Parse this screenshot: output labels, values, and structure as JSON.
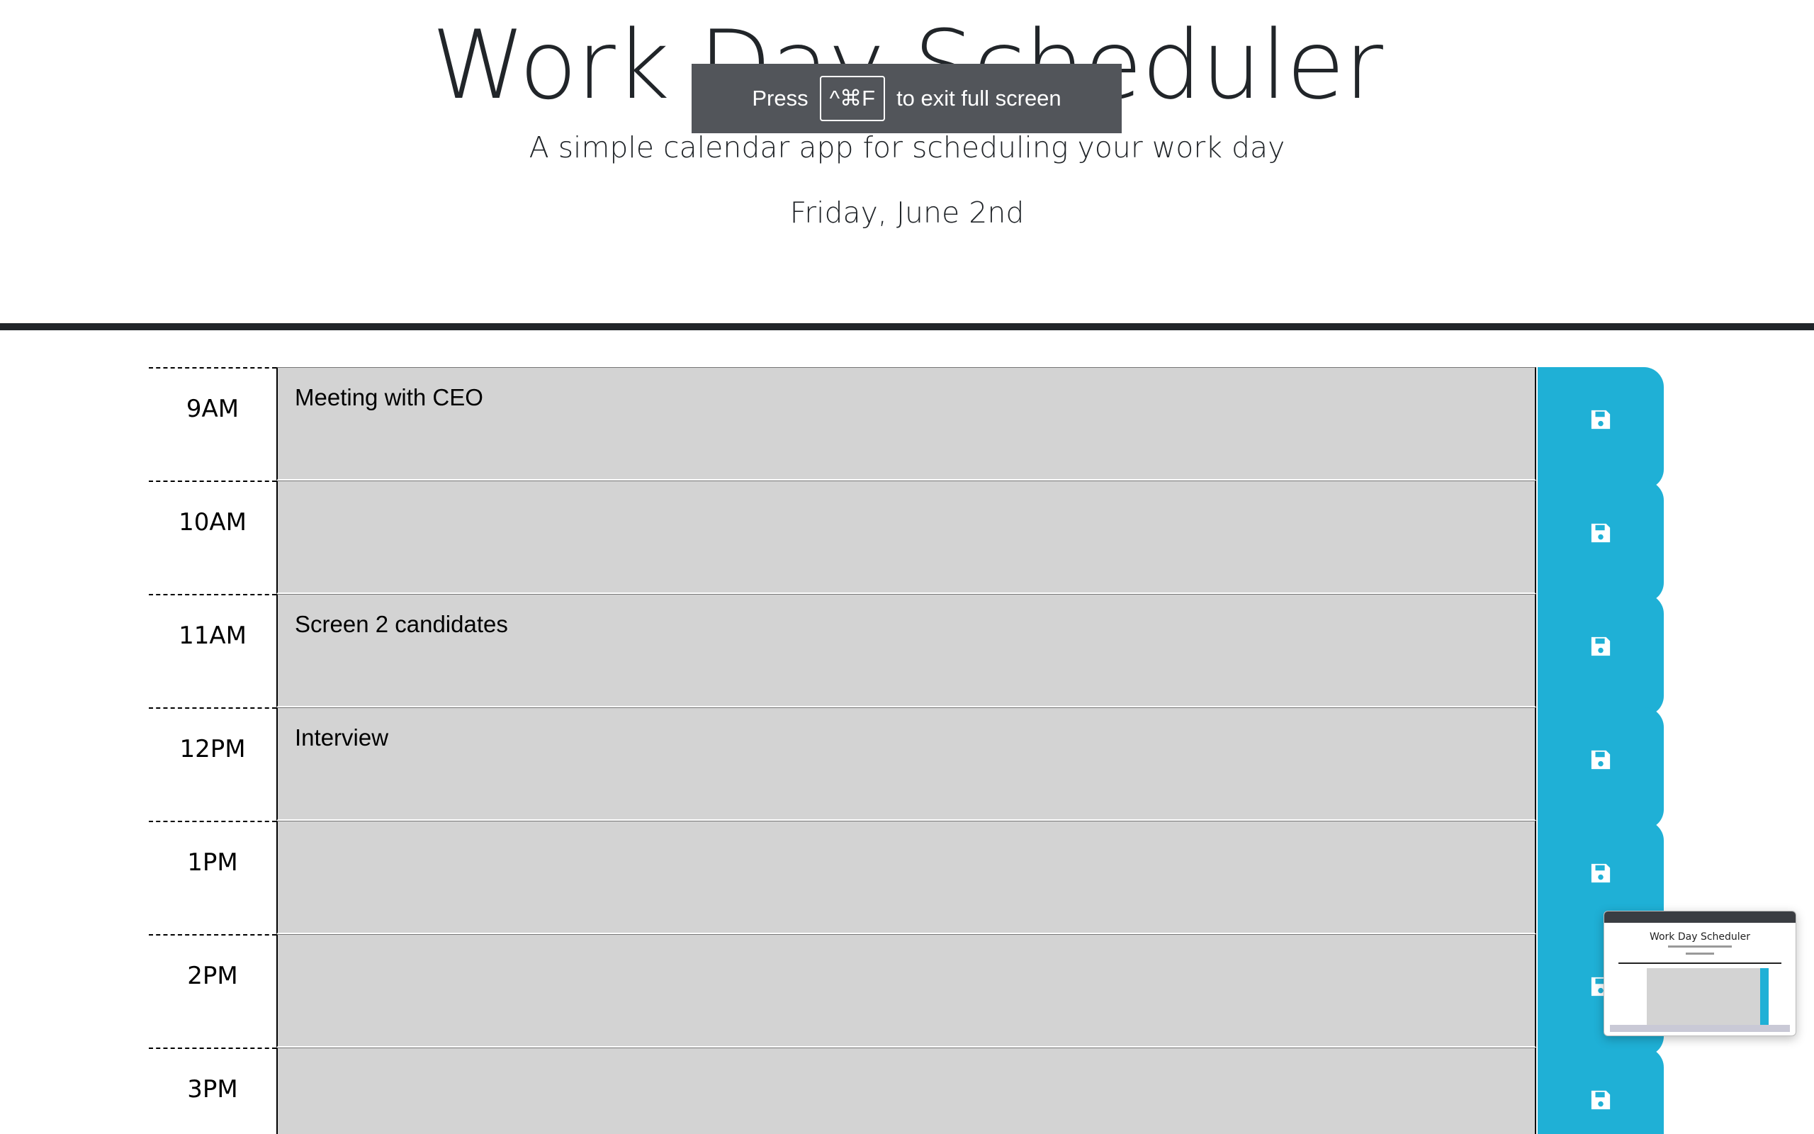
{
  "header": {
    "title": "Work Day Scheduler",
    "lead": "A simple calendar app for scheduling your work day",
    "current_day": "Friday, June 2nd"
  },
  "fullscreen_toast": {
    "press": "Press",
    "key": "^⌘F",
    "message": "to exit full screen"
  },
  "rows": [
    {
      "hour": "9AM",
      "task": "Meeting with CEO"
    },
    {
      "hour": "10AM",
      "task": ""
    },
    {
      "hour": "11AM",
      "task": "Screen 2 candidates"
    },
    {
      "hour": "12PM",
      "task": "Interview"
    },
    {
      "hour": "1PM",
      "task": ""
    },
    {
      "hour": "2PM",
      "task": ""
    },
    {
      "hour": "3PM",
      "task": ""
    }
  ],
  "thumbnail": {
    "title": "Work Day Scheduler"
  },
  "colors": {
    "save_button": "#1fb0d6",
    "task_past": "#d3d3d3",
    "rule": "#212529"
  },
  "icons": {
    "save": "floppy-disk-icon"
  }
}
